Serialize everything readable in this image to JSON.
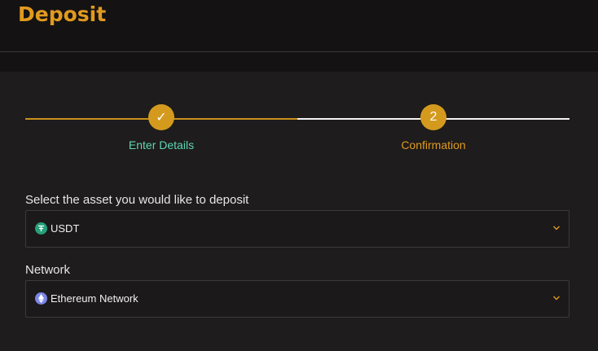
{
  "header": {
    "title": "Deposit"
  },
  "stepper": {
    "steps": [
      {
        "label": "Enter Details",
        "marker": "✓",
        "state": "completed"
      },
      {
        "label": "Confirmation",
        "marker": "2",
        "state": "active"
      }
    ]
  },
  "form": {
    "asset_label": "Select the asset you would like to deposit",
    "asset_value": "USDT",
    "asset_icon": "tether-icon",
    "network_label": "Network",
    "network_value": "Ethereum Network",
    "network_icon": "ethereum-icon"
  },
  "colors": {
    "accent": "#e19a1f",
    "success": "#5ed6b3",
    "tether": "#26a17b",
    "ethereum": "#7b86e6"
  }
}
